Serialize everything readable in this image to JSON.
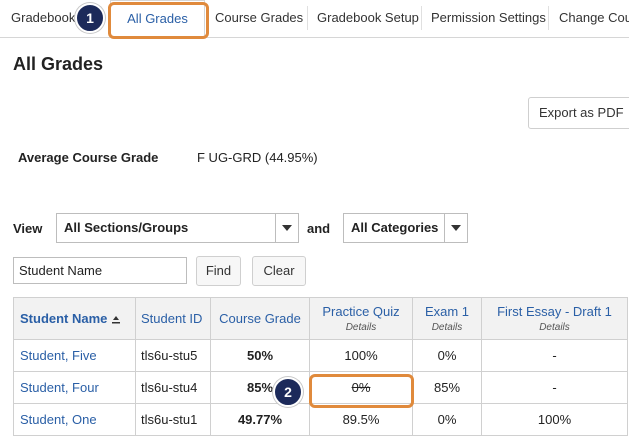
{
  "tabs": [
    {
      "label": "Gradebook"
    },
    {
      "label": "All Grades"
    },
    {
      "label": "Course Grades"
    },
    {
      "label": "Gradebook Setup"
    },
    {
      "label": "Permission Settings"
    },
    {
      "label": "Change Cour"
    }
  ],
  "steps": {
    "one": "1",
    "two": "2"
  },
  "page_title": "All Grades",
  "export_label": "Export as PDF",
  "average": {
    "label": "Average Course Grade",
    "value": "F UG-GRD (44.95%)"
  },
  "filters": {
    "view_label": "View",
    "section_value": "All Sections/Groups",
    "and_label": "and",
    "category_value": "All Categories",
    "search_value": "Student Name",
    "find_label": "Find",
    "clear_label": "Clear"
  },
  "table": {
    "headers": {
      "name": "Student Name",
      "id": "Student ID",
      "course": "Course Grade",
      "quiz": "Practice Quiz",
      "exam": "Exam 1",
      "essay": "First Essay - Draft 1",
      "details": "Details"
    },
    "rows": [
      {
        "name": "Student, Five",
        "id": "tls6u-stu5",
        "course": "50%",
        "quiz": "100%",
        "exam": "0%",
        "essay": "-"
      },
      {
        "name": "Student, Four",
        "id": "tls6u-stu4",
        "course": "85%",
        "quiz": "0%",
        "exam": "85%",
        "essay": "-"
      },
      {
        "name": "Student, One",
        "id": "tls6u-stu1",
        "course": "49.77%",
        "quiz": "89.5%",
        "exam": "0%",
        "essay": "100%"
      }
    ]
  },
  "colors": {
    "accent": "#2a5fa6",
    "highlight": "#e08a3c",
    "badge": "#1c2a5a"
  }
}
